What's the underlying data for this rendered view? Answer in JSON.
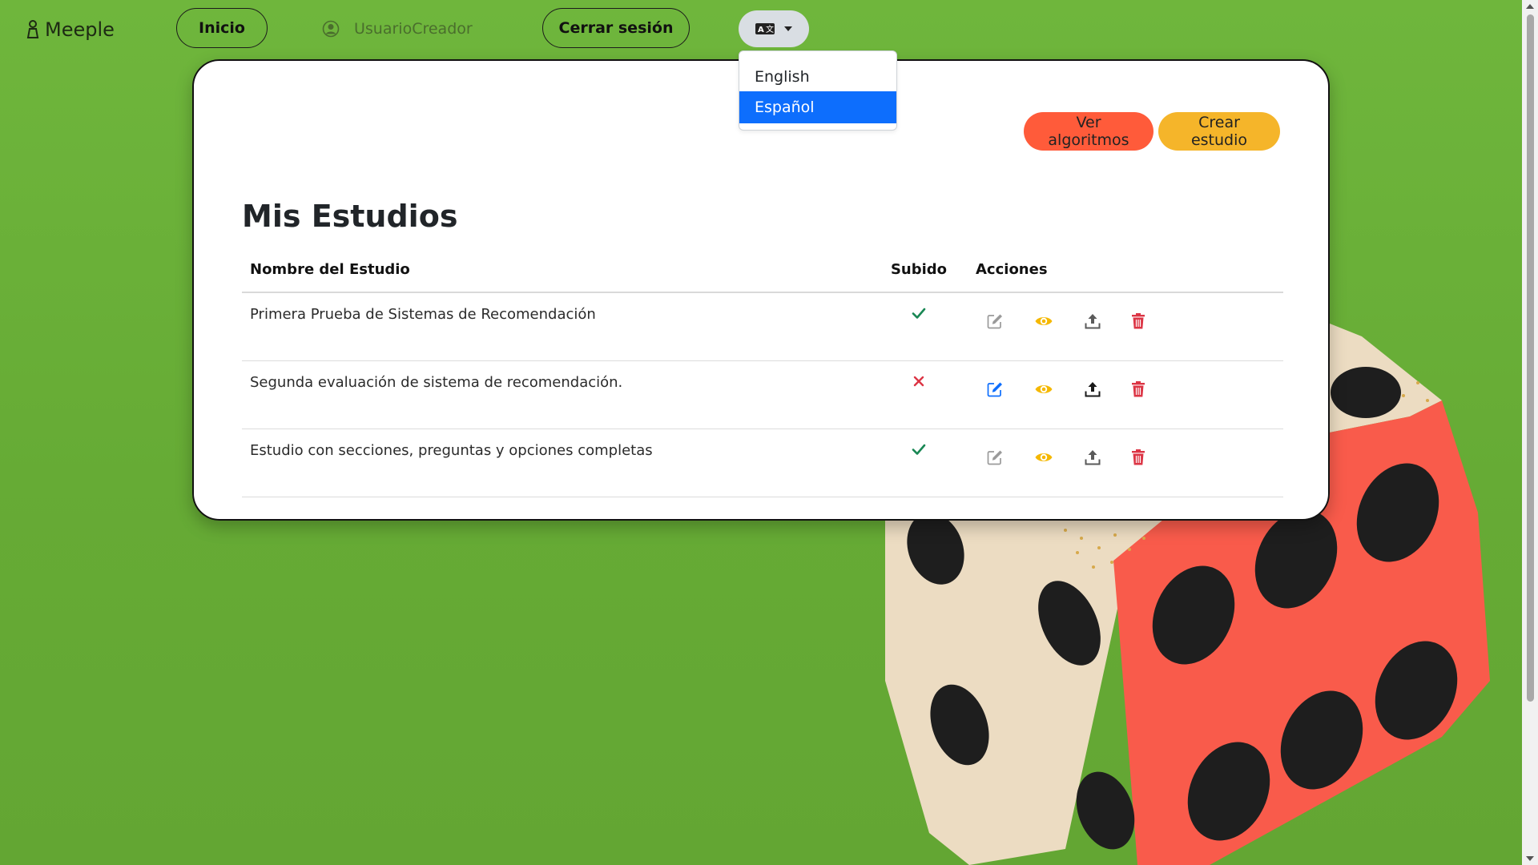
{
  "navbar": {
    "brand": "Meeple",
    "home_label": "Inicio",
    "username": "UsuarioCreador",
    "logout_label": "Cerrar sesión",
    "language_icon": "language-icon"
  },
  "language_menu": {
    "options": [
      "English",
      "Español"
    ],
    "selected": "Español"
  },
  "card": {
    "buttons": {
      "algorithms": "Ver algoritmos",
      "create": "Crear estudio"
    },
    "title": "Mis Estudios",
    "table": {
      "headers": [
        "Nombre del Estudio",
        "Subido",
        "Acciones"
      ],
      "rows": [
        {
          "name": "Primera Prueba de Sistemas de Recomendación",
          "uploaded": true
        },
        {
          "name": "Segunda evaluación de sistema de recomendación.",
          "uploaded": false
        },
        {
          "name": "Estudio con secciones, preguntas y opciones completas",
          "uploaded": true
        }
      ],
      "action_icons": [
        "edit-icon",
        "view-icon",
        "upload-icon",
        "delete-icon"
      ]
    }
  },
  "colors": {
    "background": "#6cb23a",
    "algorithms_button": "#ff5b3a",
    "create_button": "#f5b52a",
    "selected_option": "#0d6efd",
    "check": "#198754",
    "cross": "#dc3545",
    "eye": "#f5b800",
    "trash": "#dc3545",
    "edit_active": "#0d6efd",
    "edit_disabled": "#9a9a9a"
  }
}
